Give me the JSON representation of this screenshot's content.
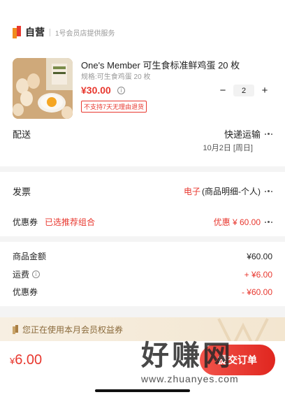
{
  "store": {
    "badge": "自营",
    "subtitle": "1号会员店提供服务"
  },
  "product": {
    "title": "One's Member 可生食标准鲜鸡蛋 20 枚",
    "spec": "规格:可生食鸡蛋 20 枚",
    "price": "¥30.00",
    "qty": "2",
    "minus": "−",
    "plus": "+",
    "notice": "不支持7天无理由退货"
  },
  "delivery": {
    "label": "配送",
    "method": "快递运输",
    "date": "10月2日 [周日]"
  },
  "invoice": {
    "label": "发票",
    "type": "电子",
    "detail": "(商品明细-个人)"
  },
  "coupon": {
    "label": "优惠券",
    "selected": "已选推荐组合",
    "value": "优惠 ¥ 60.00"
  },
  "summary": {
    "goods_label": "商品金额",
    "goods_value": "¥60.00",
    "shipping_label": "运费",
    "shipping_value": "+ ¥6.00",
    "coupon_label": "优惠券",
    "coupon_value": "- ¥60.00"
  },
  "member_banner": "您正在使用本月会员权益券",
  "footer": {
    "total_symbol": "¥",
    "total_value": "6.00",
    "submit_label": "提交订单"
  },
  "watermark": {
    "brand": "好赚网",
    "url": "www.zhuanyes.com"
  },
  "colors": {
    "accent": "#e8382f",
    "banner_bg": "#f7efe2",
    "banner_text": "#8a6a3b",
    "brand_orange": "#f08c1e"
  }
}
